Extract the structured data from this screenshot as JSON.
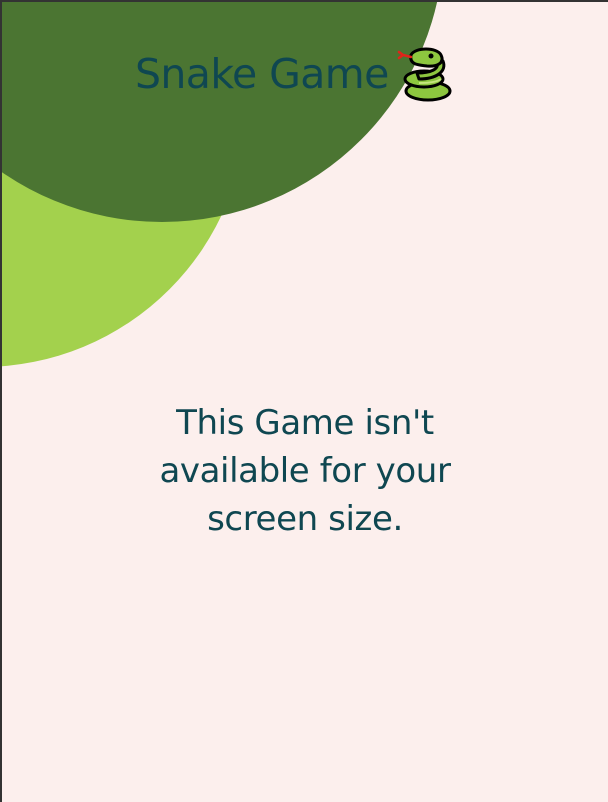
{
  "header": {
    "title": "Snake Game",
    "icon": "snake-icon"
  },
  "message": {
    "text": "This Game isn't available for your screen size."
  },
  "colors": {
    "background": "#fcefed",
    "title_text": "#0f4751",
    "circle_dark": "#4b7532",
    "circle_light": "#a3d14d"
  }
}
